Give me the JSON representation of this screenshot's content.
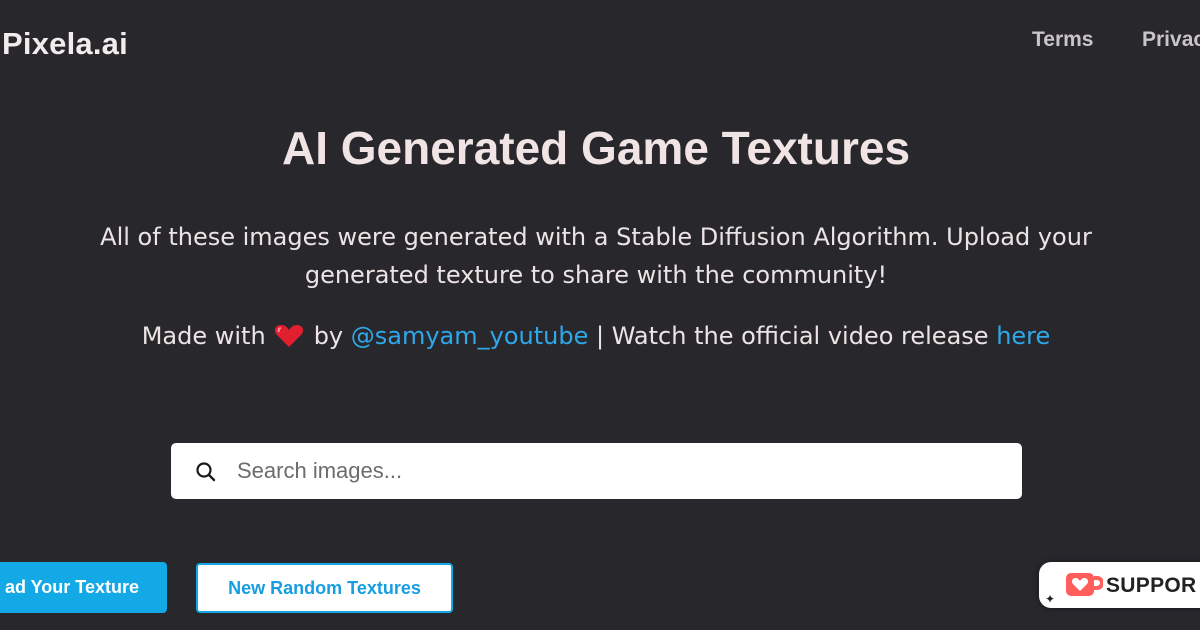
{
  "header": {
    "brand": "Pixela.ai",
    "nav": [
      {
        "label": "Terms"
      },
      {
        "label": "Privac"
      }
    ]
  },
  "hero": {
    "title": "AI Generated Game Textures",
    "description": "All of these images were generated with a Stable Diffusion Algorithm. Upload your generated texture to share with the community!",
    "credit": {
      "made_with": "Made with",
      "heart_icon": "heart-icon",
      "by": "by",
      "author": "@samyam_youtube",
      "separator_text": "| Watch the official video release",
      "video_link": "here"
    }
  },
  "search": {
    "placeholder": "Search images...",
    "value": "",
    "icon": "search-icon"
  },
  "actions": {
    "upload_label": "ad Your Texture",
    "random_label": "New Random Textures"
  },
  "support_badge": {
    "label": "SUPPOR",
    "icon": "kofi-cup-heart-icon"
  },
  "colors": {
    "background": "#28272c",
    "accent": "#13a8e6",
    "heart": "#e0202f",
    "text": "#f0e4e4"
  }
}
